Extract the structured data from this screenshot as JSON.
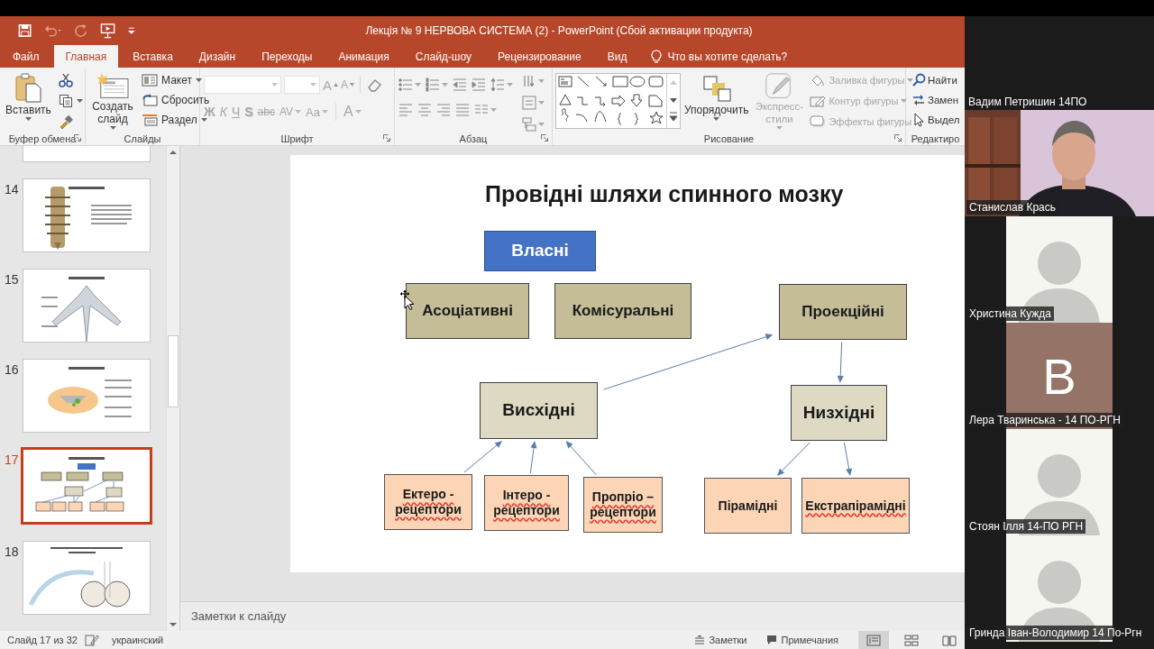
{
  "quick_access": [
    {
      "kind": "save",
      "disabled": false
    },
    {
      "kind": "undo",
      "disabled": true
    },
    {
      "kind": "redo",
      "disabled": true
    },
    {
      "kind": "present",
      "disabled": false
    },
    {
      "kind": "customize",
      "disabled": false
    }
  ],
  "window": {
    "title": "Лекція № 9 НЕРВОВА СИСТЕМА (2) - PowerPoint (Сбой активации продукта)"
  },
  "tabs": [
    {
      "label": "Файл",
      "selected": false
    },
    {
      "label": "Главная",
      "selected": true
    },
    {
      "label": "Вставка",
      "selected": false
    },
    {
      "label": "Дизайн",
      "selected": false
    },
    {
      "label": "Переходы",
      "selected": false
    },
    {
      "label": "Анимация",
      "selected": false
    },
    {
      "label": "Слайд-шоу",
      "selected": false
    },
    {
      "label": "Рецензирование",
      "selected": false
    },
    {
      "label": "Вид",
      "selected": false
    }
  ],
  "tell_me": "Что вы хотите сделать?",
  "ribbon_groups": [
    {
      "kind": "clipboard",
      "label": "Буфер обмена",
      "paste": "Вставить"
    },
    {
      "kind": "slides",
      "label": "Слайды",
      "new_slide": "Создать слайд",
      "items": [
        {
          "label": "Макет"
        },
        {
          "label": "Сбросить"
        },
        {
          "label": "Раздел"
        }
      ]
    },
    {
      "kind": "font",
      "label": "Шрифт",
      "fields_disabled": true,
      "size_buttons": [
        {
          "label": "A",
          "kind": "grow",
          "disabled": true
        },
        {
          "label": "A",
          "kind": "shrink",
          "disabled": true
        }
      ],
      "format_buttons": [
        {
          "label": "Ж",
          "kind": "bold",
          "disabled": true
        },
        {
          "label": "К",
          "kind": "italic",
          "disabled": true
        },
        {
          "label": "Ч",
          "kind": "underline",
          "disabled": true
        },
        {
          "label": "S",
          "kind": "shadow",
          "disabled": true
        },
        {
          "label": "abc",
          "kind": "strike",
          "disabled": true
        },
        {
          "label": "AV",
          "kind": "spacing",
          "disabled": true
        },
        {
          "label": "Aa",
          "kind": "case",
          "disabled": true
        },
        {
          "label": "A",
          "kind": "color",
          "disabled": true
        }
      ]
    },
    {
      "kind": "paragraph",
      "label": "Абзац"
    },
    {
      "kind": "drawing",
      "label": "Рисование",
      "arrange": "Упорядочить",
      "quick_styles": {
        "label": "Экспресс-стили",
        "disabled": true
      },
      "shape_format": [
        {
          "label": "Заливка фигуры",
          "disabled": true
        },
        {
          "label": "Контур фигуры",
          "disabled": true
        },
        {
          "label": "Эффекты фигуры",
          "disabled": true
        }
      ]
    },
    {
      "kind": "editing",
      "label": "Редактиро",
      "items": [
        {
          "label": "Найти"
        },
        {
          "label": "Замен"
        },
        {
          "label": "Выдел"
        }
      ]
    }
  ],
  "thumbnails": [
    {
      "kind": "nerve",
      "selected": false
    },
    {
      "number": "14",
      "kind": "spine",
      "selected": false
    },
    {
      "number": "15",
      "kind": "vertebra",
      "selected": false
    },
    {
      "number": "16",
      "kind": "cross_section",
      "selected": false
    },
    {
      "number": "17",
      "kind": "diagram",
      "selected": true
    },
    {
      "number": "18",
      "kind": "pathway",
      "selected": false
    }
  ],
  "slide": {
    "title": "Провідні шляхи спинного мозку",
    "boxes": [
      {
        "text": "Власні",
        "kind": "header",
        "spell_flag": false
      },
      {
        "text": "Асоціативні",
        "kind": "category",
        "spell_flag": false
      },
      {
        "text": "Комісуральні",
        "kind": "category",
        "spell_flag": false
      },
      {
        "text": "Проекційні",
        "kind": "category",
        "spell_flag": false
      },
      {
        "text": "Висхідні",
        "kind": "direction",
        "spell_flag": false
      },
      {
        "text": "Низхідні",
        "kind": "direction",
        "spell_flag": false
      },
      {
        "text": "Ектеро - рецептори",
        "kind": "receptor",
        "spell_flag": true
      },
      {
        "text": "Інтеро - рецептори",
        "kind": "receptor",
        "spell_flag": true
      },
      {
        "text": "Пропріо – рецептори",
        "kind": "receptor",
        "spell_flag": true
      },
      {
        "text": "Пірамідні",
        "kind": "receptor",
        "spell_flag": false
      },
      {
        "text": "Екстрапірамідні",
        "kind": "receptor",
        "spell_flag": true
      }
    ]
  },
  "notes": {
    "placeholder": "Заметки к слайду"
  },
  "status_bar": {
    "slide_counter": "Слайд 17 из 32",
    "language": "украинский",
    "notes_button": "Заметки",
    "comments_button": "Примечания",
    "views": [
      {
        "kind": "normal",
        "selected": true
      },
      {
        "kind": "sorter",
        "selected": false
      },
      {
        "kind": "reading",
        "selected": false
      }
    ]
  },
  "participants": [
    {
      "name": "Вадим Петришин 14ПО",
      "kind": "label"
    },
    {
      "name": "Станислав Крась",
      "kind": "video"
    },
    {
      "name": "Христина Кужда",
      "kind": "avatar"
    },
    {
      "name": "Лера Тваринська - 14 ПО-РГН",
      "kind": "initial",
      "initial": "B",
      "color": "#957366"
    },
    {
      "name": "Стоян Ілля 14-ПО РГН",
      "kind": "avatar"
    },
    {
      "name": "Гринда Іван-Володимир 14 По-Ргн",
      "kind": "avatar"
    }
  ]
}
